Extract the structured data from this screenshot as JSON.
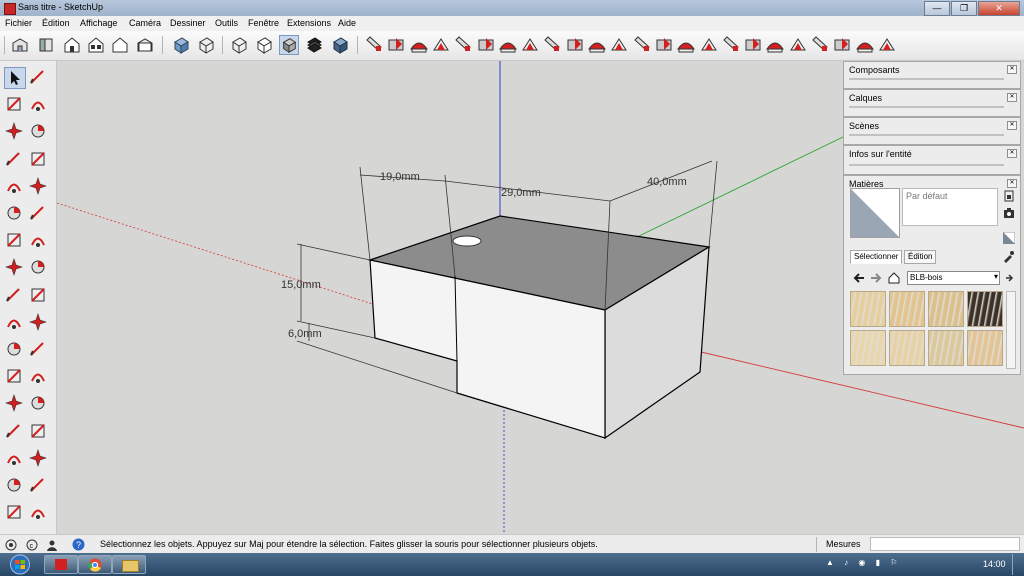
{
  "window": {
    "title": "Sans titre - SketchUp",
    "btn_min": "—",
    "btn_max": "❐",
    "btn_close": "✕"
  },
  "menu": [
    "Fichier",
    "Édition",
    "Affichage",
    "Caméra",
    "Dessiner",
    "Outils",
    "Fenêtre",
    "Extensions",
    "Aide"
  ],
  "toolbar": {
    "views": [
      "iso-view-icon",
      "top-view-icon",
      "front-view-icon",
      "right-view-icon",
      "back-view-icon",
      "left-view-icon"
    ],
    "styles": [
      "xray-icon",
      "backedges-icon",
      "wireframe-icon",
      "hiddenline-icon",
      "shaded-icon",
      "shaded-texture-icon",
      "monochrome-icon"
    ],
    "selected_style": "shaded-icon",
    "sandbox_count": 24
  },
  "left_tools": [
    "select-icon",
    "component-icon",
    "paint-bucket-icon",
    "eraser-icon",
    "line-icon",
    "freehand-icon",
    "rectangle-icon",
    "rotated-rectangle-icon",
    "circle-icon",
    "polygon-icon",
    "arc-icon",
    "pie-icon",
    "three-point-arc-icon",
    "two-point-arc-icon",
    "move-icon",
    "push-pull-icon",
    "rotate-icon",
    "follow-me-icon",
    "scale-icon",
    "offset-icon",
    "tape-measure-icon",
    "dimension-icon",
    "protractor-icon",
    "text-icon",
    "axes-icon",
    "3d-text-icon",
    "orbit-icon",
    "pan-icon",
    "zoom-icon",
    "zoom-window-icon",
    "zoom-extents-icon",
    "previous-view-icon",
    "position-camera-icon",
    "look-around-icon"
  ],
  "dimensions": {
    "d1": "19,0mm",
    "d2": "29,0mm",
    "d3": "40,0mm",
    "d4": "15,0mm",
    "d5": "6,0mm"
  },
  "tray": {
    "panels": [
      "Composants",
      "Calques",
      "Scènes",
      "Infos sur l'entité"
    ],
    "materials": {
      "title": "Matières",
      "default_name": "Par défaut",
      "tab_select": "Sélectionner",
      "tab_edit": "Édition",
      "collection": "BLB-bois",
      "swatch_colors": [
        "#e6cf9c",
        "#e2c48c",
        "#dcc08a",
        "#3d3126",
        "#ead6ab",
        "#e8d1a2",
        "#dcc99a",
        "#e3c492"
      ]
    }
  },
  "status": {
    "message": "Sélectionnez les objets. Appuyez sur Maj pour étendre la sélection. Faites glisser la souris pour sélectionner plusieurs objets.",
    "measures_label": "Mesures"
  },
  "taskbar": {
    "time": "14:00"
  },
  "colors": {
    "axis_red": "#d23a3a",
    "axis_green": "#2aa52a",
    "axis_blue": "#2a2ac8",
    "sketchup_red": "#d21f1f",
    "viewport": "#d6d6d4"
  }
}
